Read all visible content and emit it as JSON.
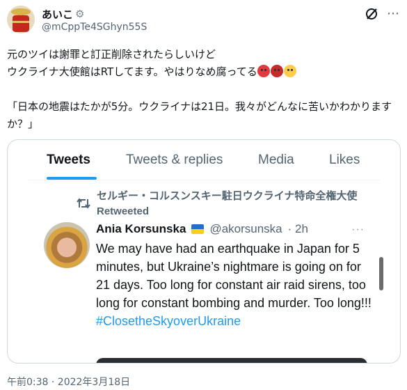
{
  "post": {
    "display_name": "あいこ",
    "handle": "@mCppTe4SGhyn55S",
    "text_line1": "元のツイは謝罪と訂正削除されたらしいけど",
    "text_line2": "ウクライナ大使館はRTしてます。やはりなめ腐ってる",
    "text_quote": "「日本の地震はたかが5分。ウクライナは21日。我々がどんなに苦いかわかりますか？」",
    "timestamp": "午前0:38 · 2022年3月18日",
    "emojis": [
      "angry-face",
      "face-with-symbols",
      "unamused-face"
    ]
  },
  "screenshot": {
    "tabs": [
      {
        "label": "Tweets",
        "active": true
      },
      {
        "label": "Tweets & replies",
        "active": false
      },
      {
        "label": "Media",
        "active": false
      },
      {
        "label": "Likes",
        "active": false
      }
    ],
    "retweet_label": "セルギー・コルスンスキー駐日ウクライナ特命全権大使 Retweeted",
    "author_name": "Ania Korsunska",
    "author_handle": "@akorsunska",
    "time_ago": "· 2h",
    "body": "We may have had an earthquake in Japan for 5 minutes, but Ukraine’s nightmare is going on for 21 days. Too long for constant air raid sirens, too long for constant bombing and murder. Too long!!!",
    "hashtag": "#ClosetheSkyoverUkraine"
  },
  "colors": {
    "accent": "#1d9bf0",
    "secondary_text": "#536471",
    "border": "#cfd9de"
  }
}
